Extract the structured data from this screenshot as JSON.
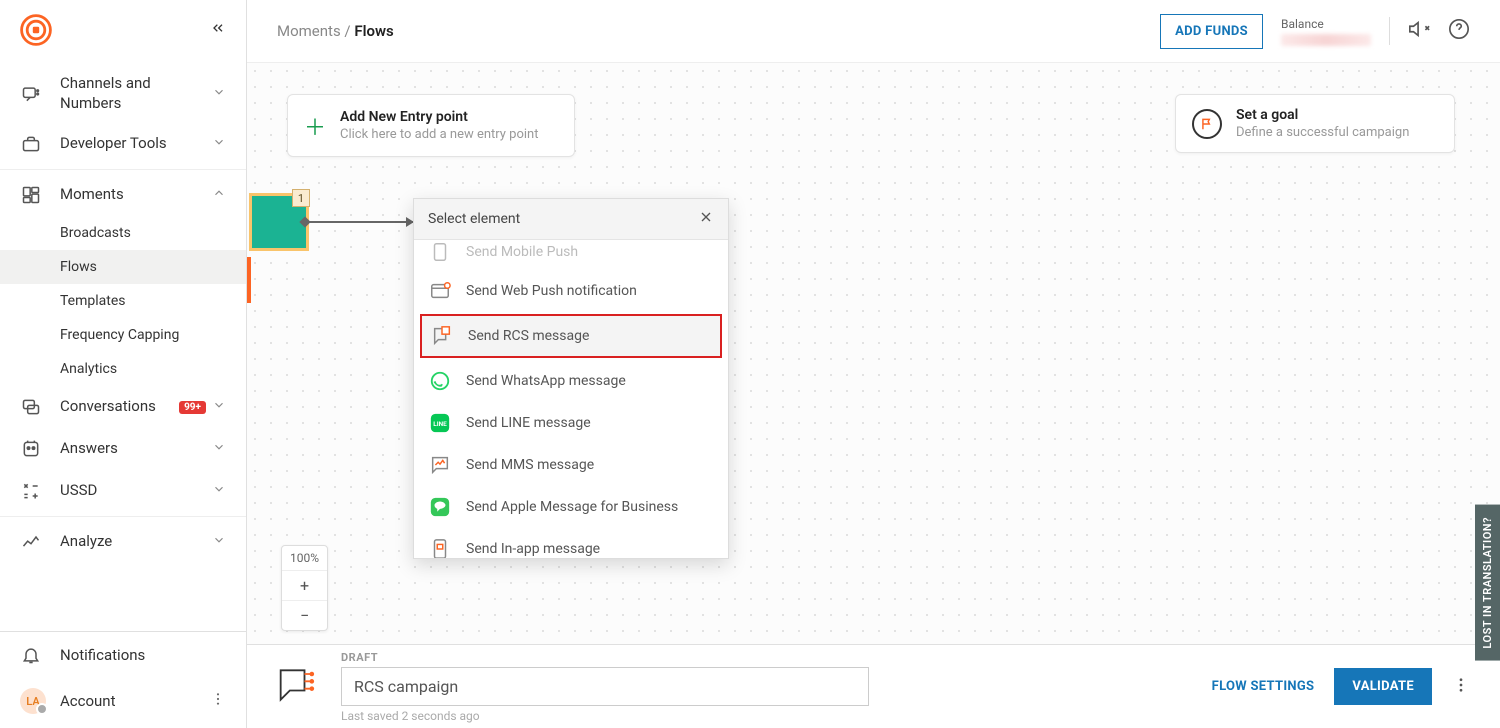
{
  "breadcrumb": {
    "parent": "Moments",
    "sep": " / ",
    "current": "Flows"
  },
  "topbar": {
    "add_funds": "ADD FUNDS",
    "balance_label": "Balance"
  },
  "sidebar": {
    "items": [
      {
        "label": "Channels and Numbers"
      },
      {
        "label": "Developer Tools"
      },
      {
        "label": "Moments"
      },
      {
        "label": "Conversations",
        "badge": "99+"
      },
      {
        "label": "Answers"
      },
      {
        "label": "USSD"
      },
      {
        "label": "Analyze"
      }
    ],
    "moments_sub": [
      {
        "label": "Broadcasts"
      },
      {
        "label": "Flows"
      },
      {
        "label": "Templates"
      },
      {
        "label": "Frequency Capping"
      },
      {
        "label": "Analytics"
      }
    ],
    "notifications": "Notifications",
    "account": "Account",
    "avatar_initials": "LA"
  },
  "canvas": {
    "entry": {
      "title": "Add New Entry point",
      "subtitle": "Click here to add a new entry point"
    },
    "goal": {
      "title": "Set a goal",
      "subtitle": "Define a successful campaign"
    },
    "node_badge": "1",
    "zoom": "100%"
  },
  "popover": {
    "title": "Select element",
    "items": [
      {
        "label": "Send Mobile Push"
      },
      {
        "label": "Send Web Push notification"
      },
      {
        "label": "Send RCS message"
      },
      {
        "label": "Send WhatsApp message"
      },
      {
        "label": "Send LINE message"
      },
      {
        "label": "Send MMS message"
      },
      {
        "label": "Send Apple Message for Business"
      },
      {
        "label": "Send In-app message"
      }
    ]
  },
  "footer": {
    "draft_label": "DRAFT",
    "flow_name": "RCS campaign",
    "saved_text": "Last saved 2 seconds ago",
    "flow_settings": "FLOW SETTINGS",
    "validate": "VALIDATE"
  },
  "side_tab": "LOST IN TRANSLATION?"
}
